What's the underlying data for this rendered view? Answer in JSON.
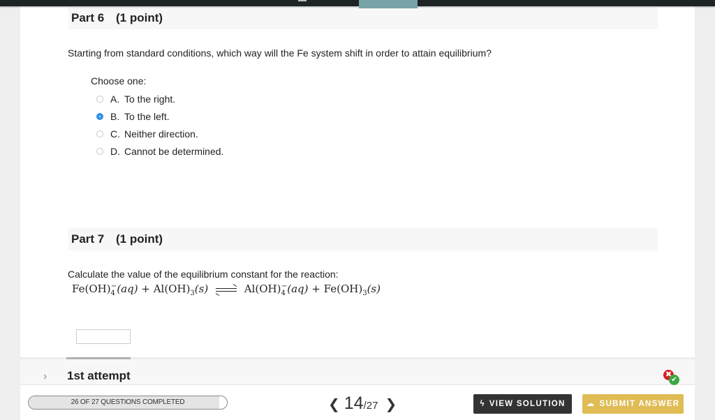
{
  "parts": [
    {
      "name": "Part 6",
      "points": "(1 point)",
      "question": "Starting from standard conditions, which way will the Fe system shift in order to attain equilibrium?",
      "choose_label": "Choose one:",
      "choices": [
        {
          "letter": "A.",
          "text": "To the right.",
          "selected": false
        },
        {
          "letter": "B.",
          "text": "To the left.",
          "selected": true
        },
        {
          "letter": "C.",
          "text": "Neither direction.",
          "selected": false
        },
        {
          "letter": "D.",
          "text": "Cannot be determined.",
          "selected": false
        }
      ]
    },
    {
      "name": "Part 7",
      "points": "(1 point)",
      "question": "Calculate the value of the equilibrium constant for the reaction:",
      "equation": {
        "reactant1": "Fe(OH)",
        "reactant1_sub": "4",
        "reactant1_sup": "−",
        "reactant1_state": "(aq)",
        "plus": "+",
        "reactant2": "Al(OH)",
        "reactant2_sub": "3",
        "reactant2_state": "(s)",
        "product1": "Al(OH)",
        "product1_sub": "4",
        "product1_sup": "−",
        "product1_state": "(aq)",
        "product2": "Fe(OH)",
        "product2_sub": "3",
        "product2_state": "(s)"
      },
      "answer_value": ""
    }
  ],
  "attempt": {
    "label": "1st attempt",
    "chevron": "›",
    "x_glyph": "✖",
    "check_glyph": "✔"
  },
  "footer": {
    "progress_text": "26 OF 27 QUESTIONS COMPLETED",
    "progress_fraction": 0.963,
    "prev_glyph": "❮",
    "next_glyph": "❯",
    "current_page": "14",
    "total_pages": "/27",
    "view_solution_icon": "ϟ",
    "view_solution_label": "VIEW SOLUTION",
    "submit_icon": "☁",
    "submit_label": "SUBMIT ANSWER"
  },
  "colors": {
    "topbar": "#1e2326",
    "active_tab": "#77a2a6",
    "radio_selected": "#2f8fe6",
    "view_solution_bg": "#333333",
    "submit_bg": "#e0bc55",
    "incorrect": "#d61f26",
    "correct": "#3aa845"
  }
}
